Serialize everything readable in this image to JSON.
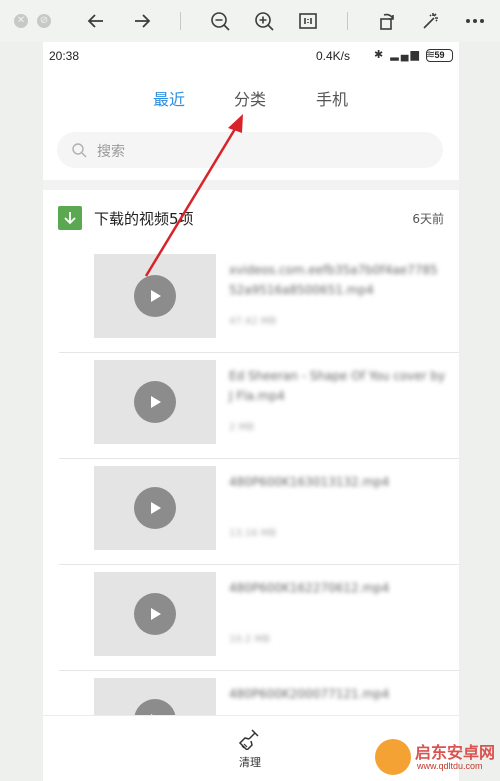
{
  "viewer": {
    "tools": [
      "close-icon",
      "minimize-icon",
      "back-arrow-icon",
      "forward-arrow-icon",
      "zoom-out-icon",
      "zoom-in-icon",
      "actual-size-icon",
      "rotate-icon",
      "magic-wand-icon",
      "more-icon"
    ]
  },
  "status_bar": {
    "time": "20:38",
    "speed": "0.4K/s",
    "battery": "59"
  },
  "tabs": [
    {
      "label": "最近",
      "active": true
    },
    {
      "label": "分类",
      "active": false
    },
    {
      "label": "手机",
      "active": false
    }
  ],
  "search": {
    "placeholder": "搜索"
  },
  "section": {
    "title": "下载的视频5项",
    "time": "6天前"
  },
  "files": [
    {
      "name": "xvideos.com.eefb35a7b0f4ae7785 52a9516a8500651.mp4",
      "size": "47.42 MB"
    },
    {
      "name": "Ed Sheeran - Shape Of You cover by J Fla.mp4",
      "size": "2 MB"
    },
    {
      "name": "480P600K163013132.mp4",
      "size": "13.16 MB"
    },
    {
      "name": "480P600K162270612.mp4",
      "size": "10.2 MB"
    },
    {
      "name": "480P600K200077121.mp4",
      "size": ""
    }
  ],
  "bottom": {
    "clean_label": "清理"
  },
  "watermark": {
    "title": "启东安卓网",
    "url": "www.qdltdu.com"
  },
  "colors": {
    "accent": "#2f8fe0",
    "download_green": "#5aa84f",
    "annotation_arrow": "#d8232a"
  }
}
